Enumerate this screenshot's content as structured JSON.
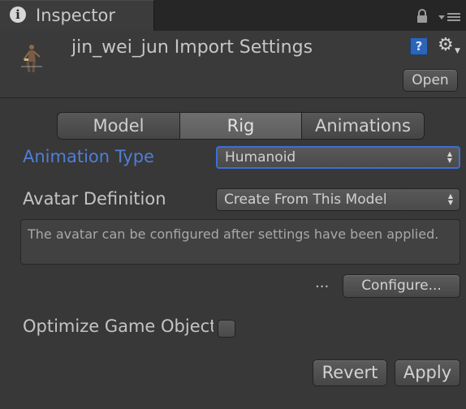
{
  "tab": {
    "title": "Inspector",
    "icon": "info-icon"
  },
  "tab_icons": {
    "lock": "lock-icon",
    "menu": "tab-menu-icon"
  },
  "header": {
    "asset_title": "jin_wei_jun Import Settings",
    "asset_icon": "model-figure-icon",
    "help_icon_text": "?",
    "gear_icon": "⚙",
    "open_label": "Open"
  },
  "tabs": [
    {
      "label": "Model",
      "selected": false
    },
    {
      "label": "Rig",
      "selected": true
    },
    {
      "label": "Animations",
      "selected": false
    }
  ],
  "animation_type": {
    "label": "Animation Type",
    "value": "Humanoid",
    "accent": "#4f7ed6"
  },
  "avatar_definition": {
    "label": "Avatar Definition",
    "value": "Create From This Model"
  },
  "help_message": "The avatar can be configured after settings have been applied.",
  "configure": {
    "ellipsis": "...",
    "label": "Configure..."
  },
  "optimize": {
    "label": "Optimize Game Object",
    "checked": false
  },
  "footer": {
    "revert_label": "Revert",
    "apply_label": "Apply"
  }
}
